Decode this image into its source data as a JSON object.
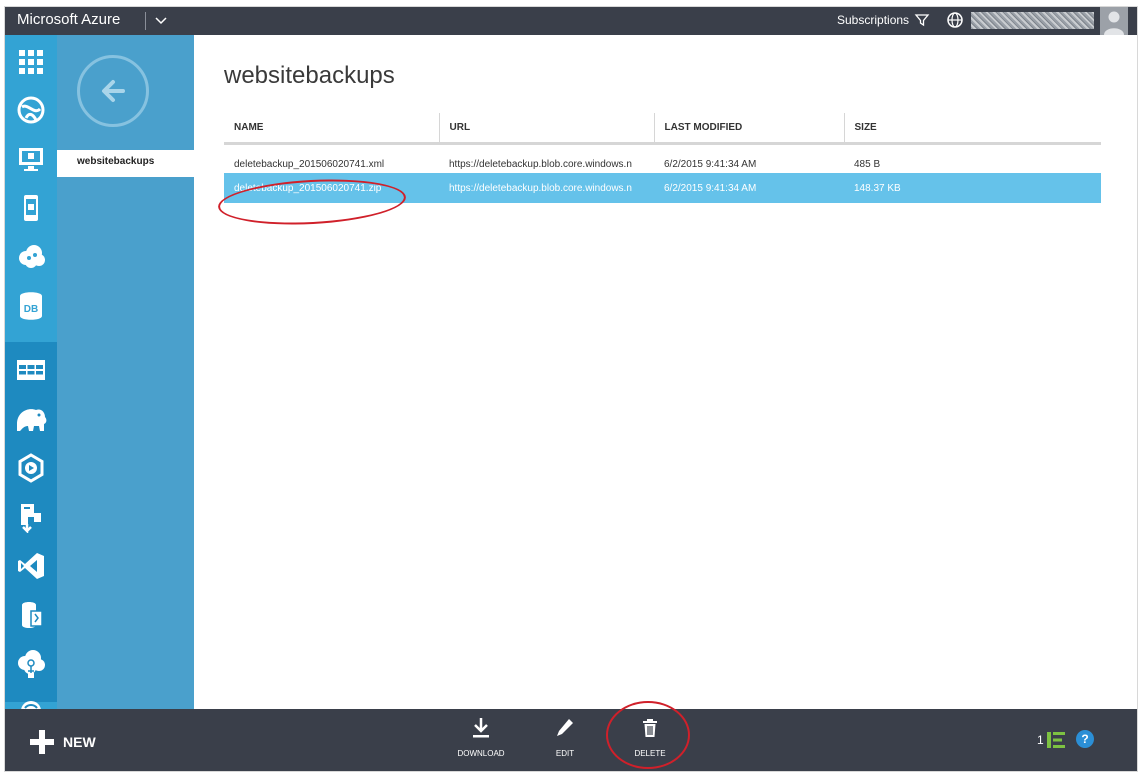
{
  "topbar": {
    "brand": "Microsoft Azure",
    "subscriptions_label": "Subscriptions"
  },
  "rail": {
    "icons": [
      "all-items-icon",
      "websites-icon",
      "virtual-machines-icon",
      "mobile-services-icon",
      "cloud-services-icon",
      "sql-databases-icon",
      "storage-icon",
      "hdinsight-icon",
      "media-services-icon",
      "service-bus-icon",
      "visual-studio-online-icon",
      "cache-icon",
      "biztalk-services-icon",
      "recovery-services-icon"
    ]
  },
  "panel2": {
    "selected_item": "websitebackups"
  },
  "main": {
    "title": "websitebackups",
    "columns": [
      "NAME",
      "URL",
      "LAST MODIFIED",
      "SIZE"
    ],
    "rows": [
      {
        "name": "deletebackup_201506020741.xml",
        "url": "https://deletebackup.blob.core.windows.n",
        "modified": "6/2/2015 9:41:34 AM",
        "size": "485 B"
      },
      {
        "name": "deletebackup_201506020741.zip",
        "url": "https://deletebackup.blob.core.windows.n",
        "modified": "6/2/2015 9:41:34 AM",
        "size": "148.37 KB"
      }
    ]
  },
  "cmdbar": {
    "new_label": "NEW",
    "download_label": "DOWNLOAD",
    "edit_label": "EDIT",
    "delete_label": "DELETE",
    "notification_count": "1",
    "help_symbol": "?"
  },
  "colors": {
    "topbar": "#3a3f4a",
    "rail": "#33a3d4",
    "panel": "#4aa0cc",
    "selected_row": "#65c2ea",
    "annotation": "#d0202a"
  }
}
